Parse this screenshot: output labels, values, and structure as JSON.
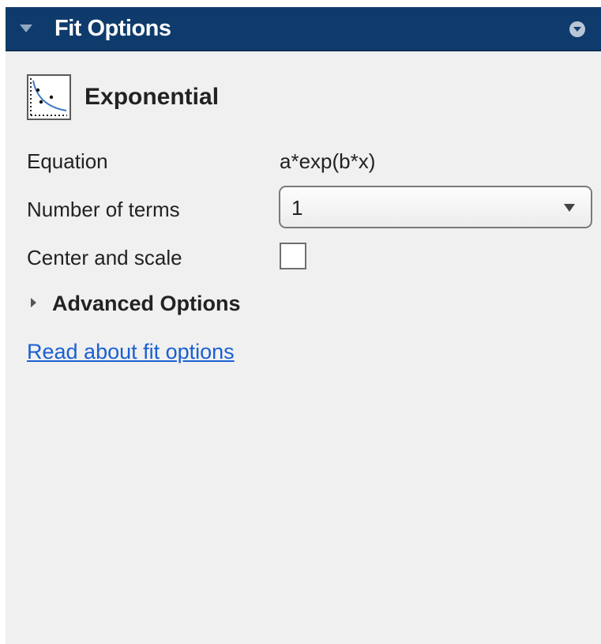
{
  "panel": {
    "title": "Fit Options"
  },
  "fit": {
    "name": "Exponential",
    "icon": "exponential-fit-icon"
  },
  "fields": {
    "equation_label": "Equation",
    "equation_value": "a*exp(b*x)",
    "terms_label": "Number of terms",
    "terms_value": "1",
    "center_scale_label": "Center and scale",
    "center_scale_checked": false
  },
  "advanced": {
    "label": "Advanced Options",
    "expanded": false
  },
  "link": {
    "label": "Read about fit options"
  },
  "colors": {
    "titlebar": "#0f3b6c",
    "background": "#f0f0f0",
    "link": "#1a5fd1"
  }
}
